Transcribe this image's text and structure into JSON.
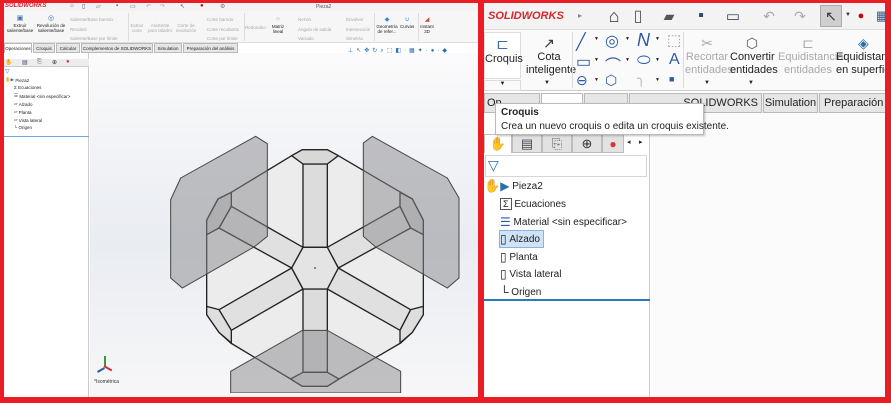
{
  "colors": {
    "frame": "#ec1c24",
    "brand": "#d8262e",
    "selection": "#cfe3f7",
    "accent": "#2a7ab8"
  },
  "left": {
    "logo": "SOLIDWORKS",
    "window_title": "Pieza2",
    "ribbon": {
      "extrude": "Extruir saliente/base",
      "revolve": "Revolución de saliente/base",
      "sweep": "Saliente/Base barrido",
      "loft": "Recubrir",
      "boundary": "Saliente/Base por límite",
      "extrude_cut": "Extruir corte",
      "hole_wizard": "Asistente para taladro",
      "revolve_cut": "Corte de revolución",
      "swept_cut": "Corte barrido",
      "lofted_cut": "Corte recubierto",
      "boundary_cut": "Corte por límite",
      "fillet": "Redondeo",
      "linear_pattern": "Matriz lineal",
      "rib": "Nervio",
      "draft": "Ángulo de salida",
      "shell": "Vaciado",
      "wrap": "Envolver",
      "intersect": "Intersección",
      "mirror": "Simetría",
      "ref_geometry": "Geometría de refer...",
      "curves": "Curvas",
      "instant3d": "Instant 3D"
    },
    "tabs": [
      "Operaciones",
      "Croquis",
      "Calcular",
      "Complementos de SOLIDWORKS",
      "Simulation",
      "Preparación del análisis"
    ],
    "tree": [
      "Pieza2",
      "Ecuaciones",
      "Material <sin especificar>",
      "Alzado",
      "Planta",
      "Vista lateral",
      "Origen"
    ],
    "view_label": "*Isométrica"
  },
  "right": {
    "logo": "SOLIDWORKS",
    "ribbon": {
      "sketch": "Croquis",
      "smart_dim": "Cota inteligente",
      "trim": "Recortar entidades",
      "convert": "Convertir entidades",
      "offset": "Equidistanciar entidades",
      "offset_surface": "Equidistanciar en superficie"
    },
    "tabs": [
      "Op",
      "SOLIDWORKS",
      "Simulation",
      "Preparación de"
    ],
    "tooltip": {
      "title": "Croquis",
      "text": "Crea un nuevo croquis o edita un croquis existente."
    },
    "tree": [
      "Pieza2",
      "Ecuaciones",
      "Material <sin especificar>",
      "Alzado",
      "Planta",
      "Vista lateral",
      "Origen"
    ]
  }
}
